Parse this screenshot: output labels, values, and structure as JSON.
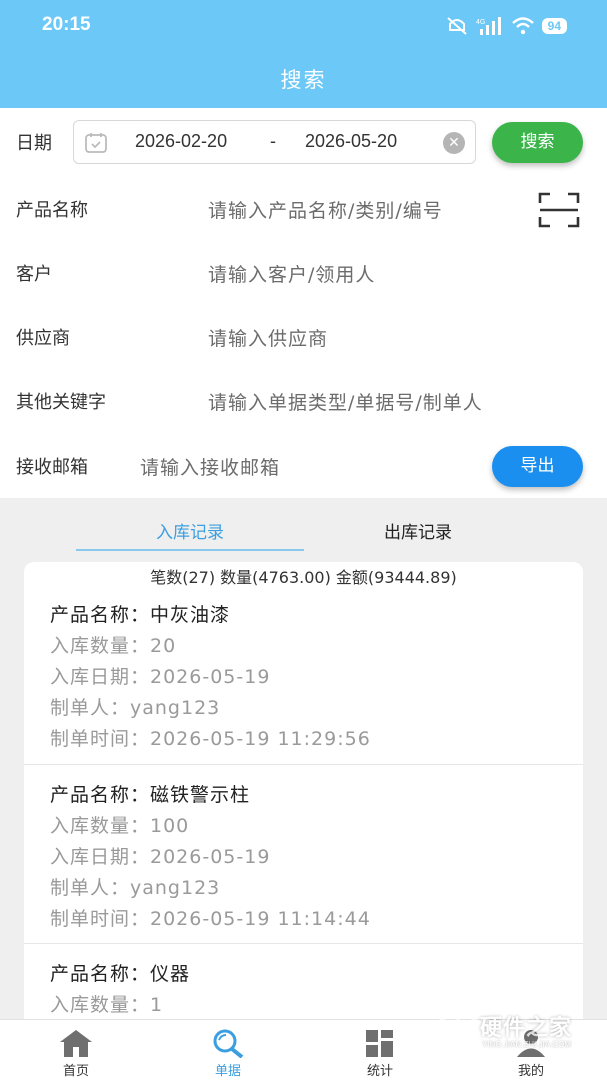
{
  "status": {
    "time": "20:15",
    "battery": "94",
    "network": "4G"
  },
  "header": {
    "title": "搜索"
  },
  "form": {
    "date_label": "日期",
    "date_start": "2026-02-20",
    "date_sep": "-",
    "date_end": "2026-05-20",
    "search_button": "搜索",
    "product_label": "产品名称",
    "product_placeholder": "请输入产品名称/类别/编号",
    "customer_label": "客户",
    "customer_placeholder": "请输入客户/领用人",
    "supplier_label": "供应商",
    "supplier_placeholder": "请输入供应商",
    "keyword_label": "其他关键字",
    "keyword_placeholder": "请输入单据类型/单据号/制单人",
    "email_label": "接收邮箱",
    "email_placeholder": "请输入接收邮箱",
    "export_button": "导出"
  },
  "tabs": {
    "inbound": "入库记录",
    "outbound": "出库记录"
  },
  "summary": "笔数(27) 数量(4763.00) 金额(93444.89)",
  "records": [
    {
      "name": "产品名称：中灰油漆",
      "qty": "入库数量：20",
      "date": "入库日期：2026-05-19",
      "maker": "制单人：yang123",
      "time": "制单时间：2026-05-19 11:29:56"
    },
    {
      "name": "产品名称：磁铁警示柱",
      "qty": "入库数量：100",
      "date": "入库日期：2026-05-19",
      "maker": "制单人：yang123",
      "time": "制单时间：2026-05-19 11:14:44"
    },
    {
      "name": "产品名称：仪器",
      "qty": "入库数量：1"
    }
  ],
  "bottom_nav": [
    {
      "label": "首页",
      "icon": "home-icon"
    },
    {
      "label": "单据",
      "icon": "search-doc-icon"
    },
    {
      "label": "统计",
      "icon": "grid-icon"
    },
    {
      "label": "我的",
      "icon": "user-icon"
    }
  ],
  "watermark": {
    "text": "硬件之家",
    "sub": "YING JIAN ZHI JIA.COM"
  },
  "colors": {
    "header": "#6cc8f7",
    "search_button": "#3bb54a",
    "export_button": "#1b8ff0",
    "active": "#3a9ee0"
  }
}
